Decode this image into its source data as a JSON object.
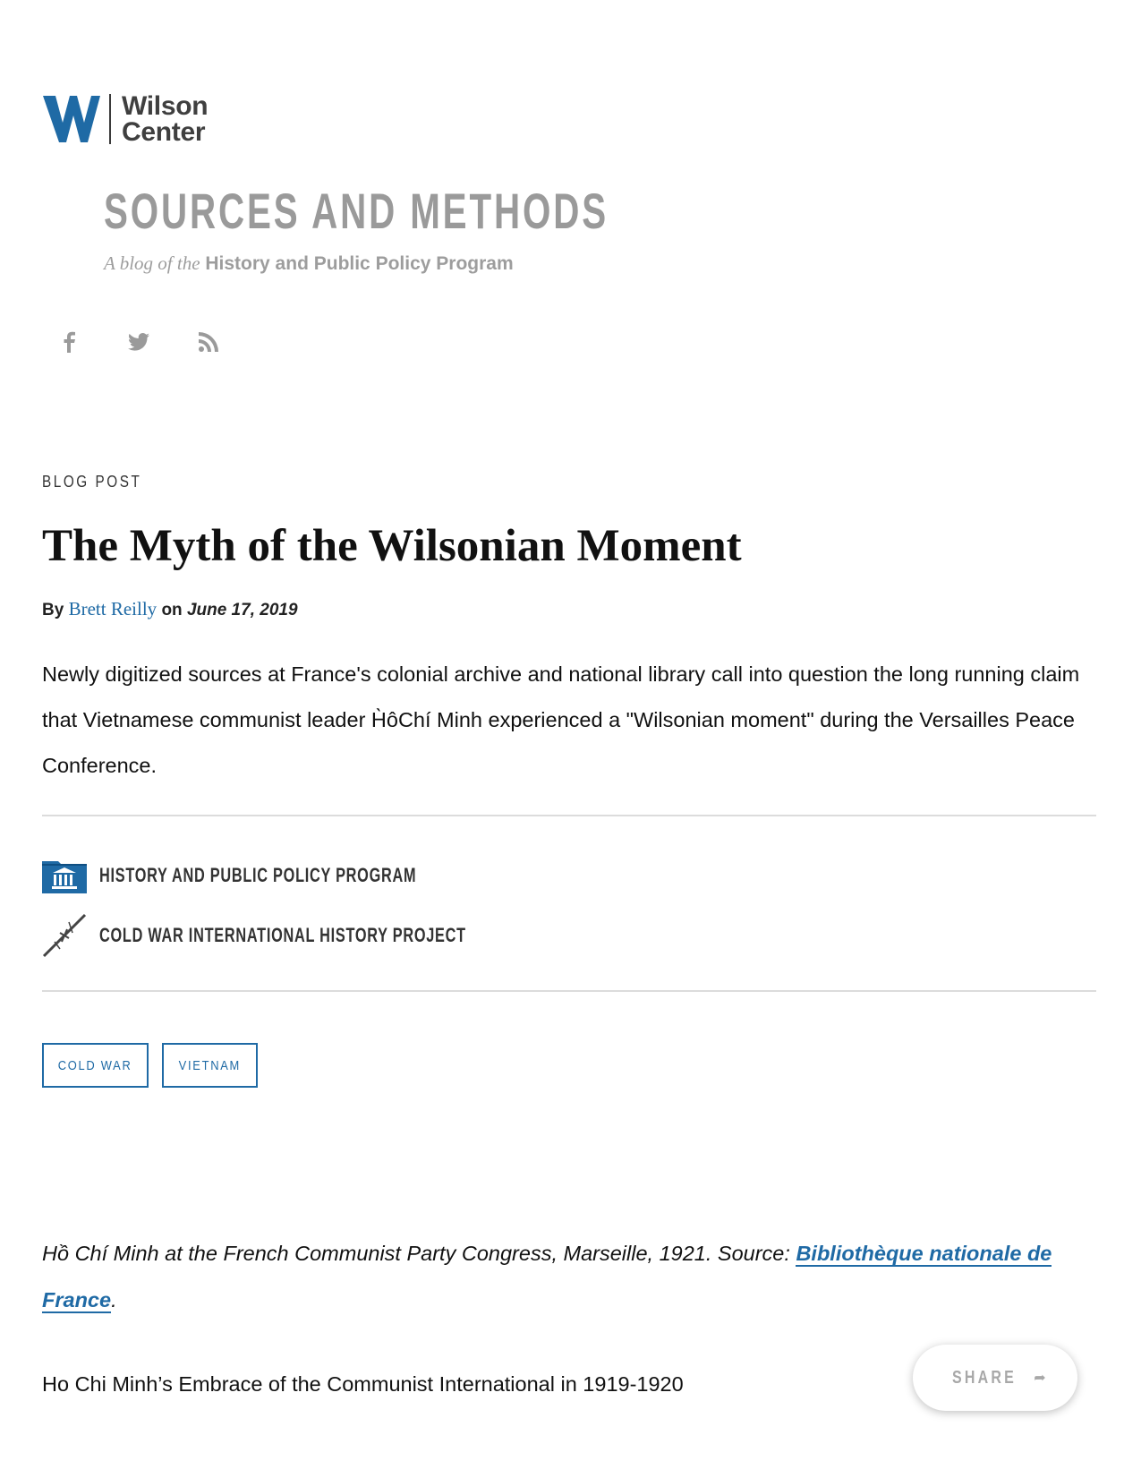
{
  "brand": {
    "line1": "Wilson",
    "line2": "Center",
    "accent": "#1f6aa5"
  },
  "blog": {
    "title": "SOURCES AND METHODS",
    "subtitle_prefix": "A blog of the",
    "subtitle_program": "History and Public Policy Program"
  },
  "social": {
    "icons": [
      "facebook-icon",
      "twitter-icon",
      "rss-icon"
    ]
  },
  "article": {
    "eyebrow": "BLOG POST",
    "title": "The Myth of the Wilsonian Moment",
    "by_label": "By",
    "author": "Brett Reilly",
    "on_label": "on",
    "date": "June 17, 2019",
    "lede": "Newly digitized sources at France's colonial archive and national library call into question the long running claim that Vietnamese communist leader H̀ôChí Minh experienced a \"Wilsonian moment\" during the Versailles Peace Conference."
  },
  "programs": [
    {
      "label": "HISTORY AND PUBLIC POLICY PROGRAM",
      "icon": "folder-building-icon"
    },
    {
      "label": "COLD WAR INTERNATIONAL HISTORY PROJECT",
      "icon": "barbed-wire-icon"
    }
  ],
  "tags": [
    "COLD WAR",
    "VIETNAM"
  ],
  "caption": {
    "text": "Hồ Chí Minh at the French Communist Party Congress, Marseille, 1921. Source: ",
    "link": "Bibliothèque nationale de France",
    "end": "."
  },
  "section_heading": "Ho Chi Minh’s Embrace of the Communist International in 1919-1920",
  "share": {
    "label": "SHARE",
    "icon": "share-arrow-icon"
  }
}
